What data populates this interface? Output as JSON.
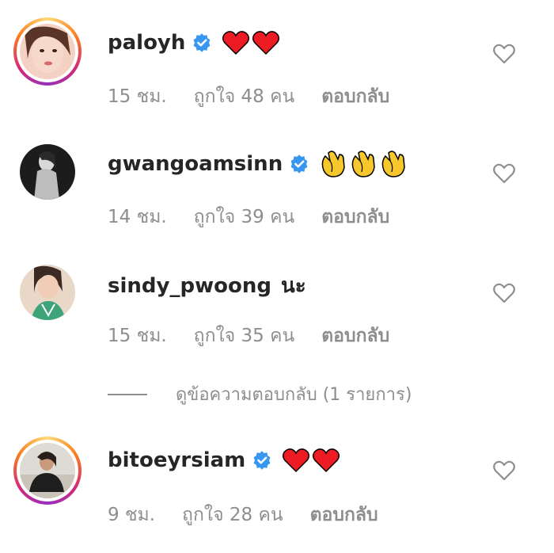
{
  "comments": [
    {
      "username": "paloyh",
      "verified": true,
      "text": "",
      "emoji": [
        "heart",
        "heart"
      ],
      "time": "15 ชม.",
      "likes": "ถูกใจ 48 คน",
      "reply": "ตอบกลับ"
    },
    {
      "username": "gwangoamsinn",
      "verified": true,
      "text": "",
      "emoji": [
        "clap",
        "clap",
        "clap"
      ],
      "time": "14 ชม.",
      "likes": "ถูกใจ 39 คน",
      "reply": "ตอบกลับ"
    },
    {
      "username": "sindy_pwoong",
      "verified": false,
      "text": "นะ",
      "emoji": [],
      "time": "15 ชม.",
      "likes": "ถูกใจ 35 คน",
      "reply": "ตอบกลับ"
    },
    {
      "username": "bitoeyrsiam",
      "verified": true,
      "text": "",
      "emoji": [
        "heart",
        "heart"
      ],
      "time": "9 ชม.",
      "likes": "ถูกใจ 28 คน",
      "reply": "ตอบกลับ"
    }
  ],
  "view_replies": "ดูข้อความตอบกลับ (1 รายการ)",
  "colors": {
    "verified": "#3897f0",
    "heart": "#ed1c24",
    "meta": "#8e8e8e",
    "username": "#262626"
  }
}
